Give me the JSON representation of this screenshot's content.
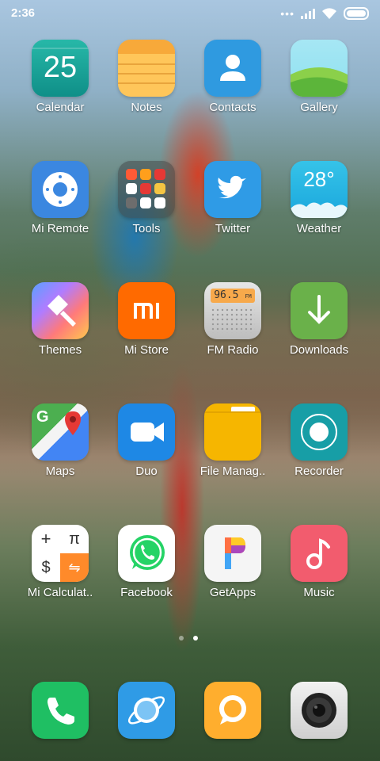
{
  "status": {
    "time": "2:36",
    "dots": "•••"
  },
  "apps": [
    {
      "label": "Calendar",
      "day": "25",
      "icon": "calendar-icon"
    },
    {
      "label": "Notes",
      "icon": "notes-icon"
    },
    {
      "label": "Contacts",
      "icon": "contacts-icon"
    },
    {
      "label": "Gallery",
      "icon": "gallery-icon"
    },
    {
      "label": "Mi Remote",
      "icon": "remote-icon"
    },
    {
      "label": "Tools",
      "icon": "folder-icon"
    },
    {
      "label": "Twitter",
      "icon": "twitter-icon"
    },
    {
      "label": "Weather",
      "temp": "28°",
      "icon": "weather-icon"
    },
    {
      "label": "Themes",
      "icon": "brush-icon"
    },
    {
      "label": "Mi Store",
      "icon": "mi-logo-icon"
    },
    {
      "label": "FM Radio",
      "freq": "96.5",
      "unit": "FM",
      "icon": "radio-icon"
    },
    {
      "label": "Downloads",
      "icon": "download-arrow-icon"
    },
    {
      "label": "Maps",
      "icon": "maps-pin-icon"
    },
    {
      "label": "Duo",
      "icon": "video-camera-icon"
    },
    {
      "label": "File Manag..",
      "icon": "folder-file-icon"
    },
    {
      "label": "Recorder",
      "icon": "record-icon"
    },
    {
      "label": "Mi Calculat..",
      "keys": [
        "+",
        "π",
        "$",
        "⇋"
      ],
      "icon": "calculator-icon"
    },
    {
      "label": "Facebook",
      "icon": "whatsapp-icon"
    },
    {
      "label": "GetApps",
      "icon": "getapps-icon"
    },
    {
      "label": "Music",
      "icon": "music-note-icon"
    }
  ],
  "dock": [
    {
      "icon": "phone-icon"
    },
    {
      "icon": "browser-icon"
    },
    {
      "icon": "message-icon"
    },
    {
      "icon": "camera-icon"
    }
  ],
  "colors": {
    "calendar": "#1aa39a",
    "notes": "#ffc14d",
    "contacts": "#2e9ae0",
    "mistore": "#ff6a00",
    "music": "#f25c6e"
  }
}
